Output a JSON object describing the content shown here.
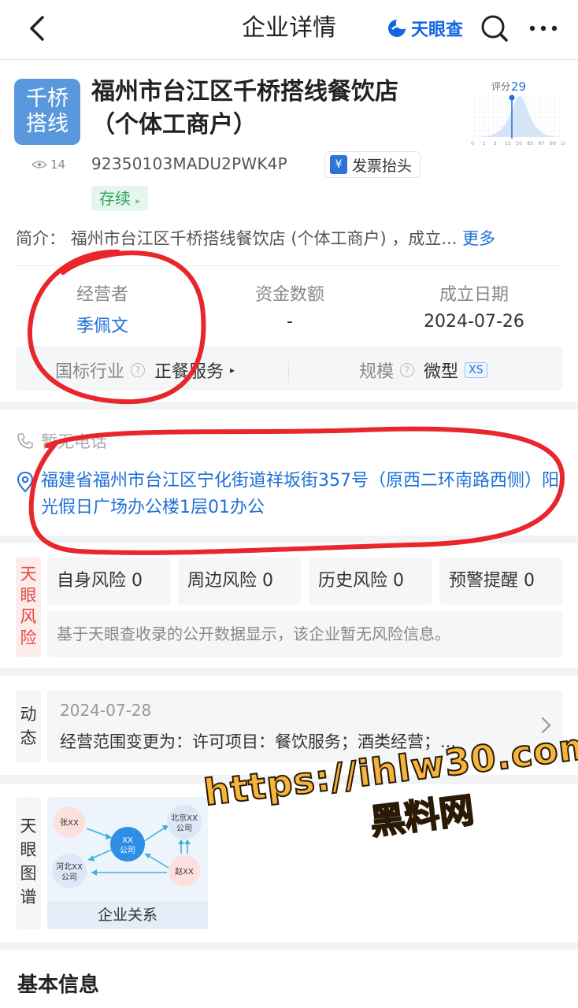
{
  "header": {
    "title": "企业详情",
    "brand": "天眼查"
  },
  "company": {
    "logo_text": "千桥\n搭线",
    "logo_line1": "千桥",
    "logo_line2": "搭线",
    "name_line1": "福州市台江区千桥搭线餐饮店",
    "name_line2": "（个体工商户）",
    "score_label": "评分",
    "score_value": "29",
    "score_axis": [
      "0",
      "1",
      "3",
      "15",
      "50",
      "85",
      "97",
      "99",
      "100"
    ],
    "views": "14",
    "credit_code": "92350103MADU2PWK4P",
    "invoice_label": "发票抬头",
    "invoice_icon": "¥",
    "status": "存续",
    "intro_label": "简介：",
    "intro_text": "福州市台江区千桥搭线餐饮店 (个体工商户) ，成立...",
    "intro_more": "更多"
  },
  "key_info": {
    "operator_label": "经营者",
    "operator_value": "季佩文",
    "capital_label": "资金数额",
    "capital_value": "-",
    "founded_label": "成立日期",
    "founded_value": "2024-07-26",
    "industry_label": "国标行业",
    "industry_value": "正餐服务",
    "scale_label": "规模",
    "scale_value": "微型",
    "scale_badge": "XS",
    "qmark": "?"
  },
  "contact": {
    "phone": "暂无电话",
    "address": "福建省福州市台江区宁化街道祥坂街357号（原西二环南路西侧）阳光假日广场办公楼1层01办公"
  },
  "risk": {
    "tag": "天眼风险",
    "items": [
      {
        "label": "自身风险",
        "count": "0"
      },
      {
        "label": "周边风险",
        "count": "0"
      },
      {
        "label": "历史风险",
        "count": "0"
      },
      {
        "label": "预警提醒",
        "count": "0"
      }
    ],
    "note": "基于天眼查收录的公开数据显示，该企业暂无风险信息。"
  },
  "news": {
    "tag": "动态",
    "date": "2024-07-28",
    "text": "经营范围变更为：许可项目：餐饮服务；酒类经营；..."
  },
  "graph": {
    "tag": "天眼图谱",
    "caption": "企业关系",
    "nodes": {
      "zhang": "张XX",
      "center1": "XX",
      "center2": "公司",
      "bj1": "北京XX",
      "bj2": "公司",
      "hb1": "河北XX",
      "hb2": "公司",
      "zhao": "赵XX"
    }
  },
  "basic": {
    "title": "基本信息"
  },
  "watermark": {
    "line1": "https://ihlw30.com",
    "line2": "黑料网"
  },
  "colors": {
    "accent": "#1f6fd6",
    "annotation_red": "#e8262b",
    "status_green": "#2da45a",
    "risk_red": "#e2483d"
  }
}
